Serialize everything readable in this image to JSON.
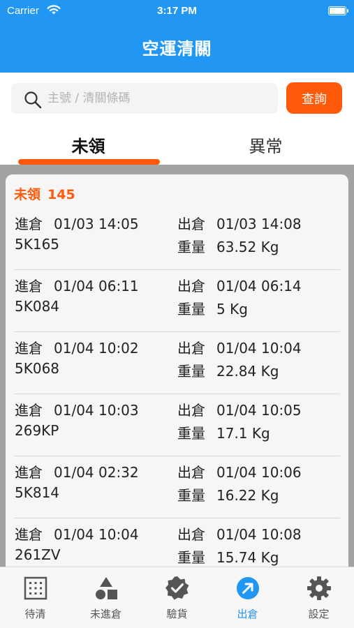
{
  "status_bar": {
    "carrier": "Carrier",
    "time": "3:17 PM"
  },
  "header": {
    "title": "空運清關"
  },
  "search": {
    "placeholder": "主號 / 清關條碼",
    "button_label": "查詢"
  },
  "tabs": [
    {
      "label": "未領",
      "active": true
    },
    {
      "label": "異常",
      "active": false
    }
  ],
  "summary": {
    "label": "未領",
    "count": "145"
  },
  "records": [
    {
      "in_label": "進倉",
      "in_time": "01/03 14:05",
      "out_label": "出倉",
      "out_time": "01/03 14:08",
      "code": "5K165",
      "weight_label": "重量",
      "weight": "63.52 Kg"
    },
    {
      "in_label": "進倉",
      "in_time": "01/04 06:11",
      "out_label": "出倉",
      "out_time": "01/04 06:14",
      "code": "5K084",
      "weight_label": "重量",
      "weight": "5 Kg"
    },
    {
      "in_label": "進倉",
      "in_time": "01/04 10:02",
      "out_label": "出倉",
      "out_time": "01/04 10:04",
      "code": "5K068",
      "weight_label": "重量",
      "weight": "22.84 Kg"
    },
    {
      "in_label": "進倉",
      "in_time": "01/04 10:03",
      "out_label": "出倉",
      "out_time": "01/04 10:05",
      "code": "269KP",
      "weight_label": "重量",
      "weight": "17.1 Kg"
    },
    {
      "in_label": "進倉",
      "in_time": "01/04 02:32",
      "out_label": "出倉",
      "out_time": "01/04 10:06",
      "code": "5K814",
      "weight_label": "重量",
      "weight": "16.22 Kg"
    },
    {
      "in_label": "進倉",
      "in_time": "01/04 10:04",
      "out_label": "出倉",
      "out_time": "01/04 10:08",
      "code": "261ZV",
      "weight_label": "重量",
      "weight": "15.74 Kg"
    }
  ],
  "bottom_nav": [
    {
      "label": "待清",
      "icon": "grid-icon",
      "active": false
    },
    {
      "label": "未進倉",
      "icon": "shapes-icon",
      "active": false
    },
    {
      "label": "驗貨",
      "icon": "verified-badge-icon",
      "active": false
    },
    {
      "label": "出倉",
      "icon": "arrow-out-circle-icon",
      "active": true
    },
    {
      "label": "設定",
      "icon": "gear-icon",
      "active": false
    }
  ],
  "colors": {
    "primary": "#2196f3",
    "accent": "#ff5a0a",
    "list_background": "#a3a3a3"
  }
}
